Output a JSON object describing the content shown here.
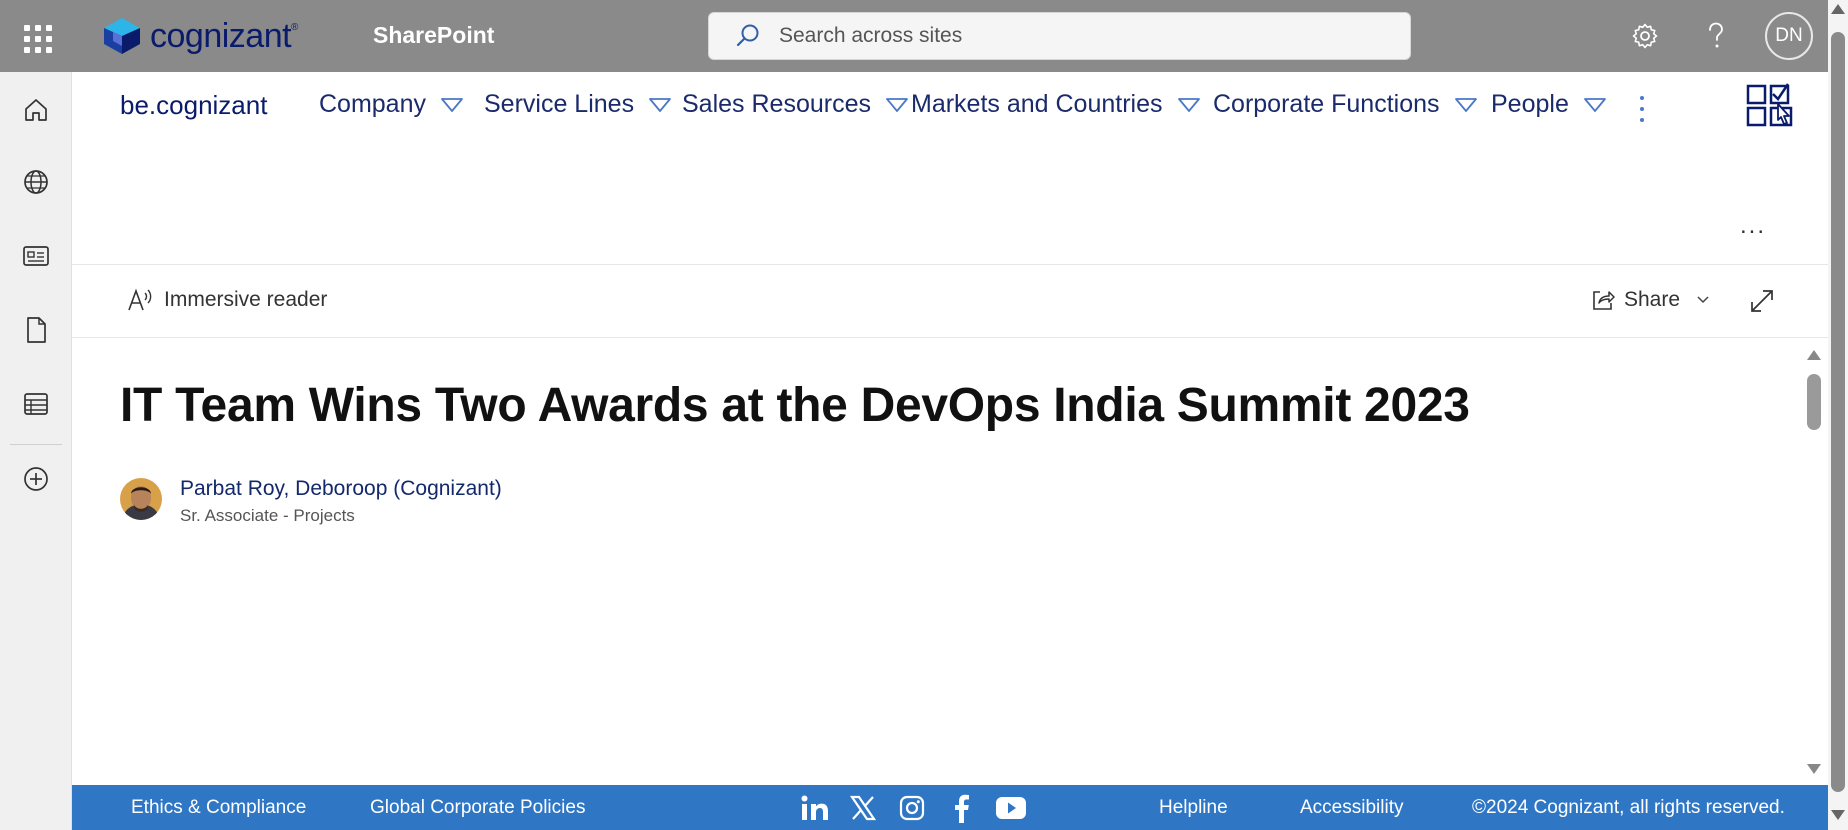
{
  "suite": {
    "logo_text": "cognizant",
    "logo_tm": "®",
    "app_name": "SharePoint",
    "search_placeholder": "Search across sites",
    "avatar_initials": "DN"
  },
  "hub": {
    "site_title": "be.cognizant",
    "nav": [
      {
        "label": "Company"
      },
      {
        "label": "Service Lines"
      },
      {
        "label": "Sales Resources"
      },
      {
        "label": "Markets and Countries"
      },
      {
        "label": "Corporate Functions"
      },
      {
        "label": "People"
      }
    ]
  },
  "page": {
    "more_label": "...",
    "immersive_reader": "Immersive reader",
    "share": "Share",
    "title": "IT Team Wins Two Awards at the DevOps India Summit 2023",
    "author_name": "Parbat Roy, Deboroop (Cognizant)",
    "author_role": "Sr. Associate - Projects"
  },
  "footer": {
    "links": [
      "Ethics & Compliance",
      "Global Corporate Policies",
      "Helpline",
      "Accessibility"
    ],
    "copyright": "©2024 Cognizant, all rights reserved."
  },
  "colors": {
    "suite_bar": "#8a8a8a",
    "footer": "#2f77c5",
    "nav_text": "#1b2a6b",
    "logo_navy": "#0a1b6b"
  },
  "icons": [
    "waffle-icon",
    "settings-icon",
    "help-icon",
    "home-icon",
    "globe-icon",
    "news-icon",
    "document-icon",
    "list-icon",
    "add-icon",
    "linkedin-icon",
    "x-icon",
    "instagram-icon",
    "facebook-icon",
    "youtube-icon"
  ]
}
